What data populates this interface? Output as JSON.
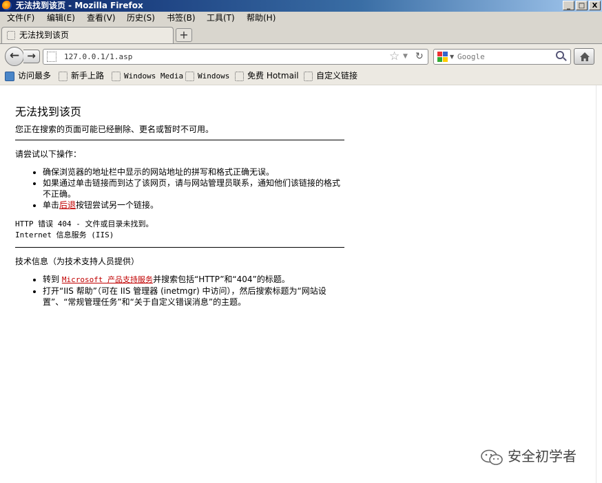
{
  "window": {
    "title": "无法找到该页 - Mozilla Firefox",
    "controls": [
      "_",
      "□",
      "X"
    ]
  },
  "menubar": [
    "文件(F)",
    "编辑(E)",
    "查看(V)",
    "历史(S)",
    "书签(B)",
    "工具(T)",
    "帮助(H)"
  ],
  "tab": {
    "label": "无法找到该页",
    "new_tab": "+"
  },
  "navigation": {
    "url": "127.0.0.1/1.asp",
    "search_placeholder": "Google"
  },
  "bookmarks": [
    "访问最多",
    "新手上路",
    "Windows Media",
    "Windows",
    "免费 Hotmail",
    "自定义链接"
  ],
  "page": {
    "heading": "无法找到该页",
    "subtitle": "您正在搜索的页面可能已经删除、更名或暂时不可用。",
    "try_label": "请尝试以下操作：",
    "tips": {
      "t1": "确保浏览器的地址栏中显示的网站地址的拼写和格式正确无误。",
      "t2": "如果通过单击链接而到达了该网页，请与网站管理员联系，通知他们该链接的格式不正确。",
      "t3_before": "单击",
      "t3_link": "后退",
      "t3_after": "按钮尝试另一个链接。"
    },
    "error_line": "HTTP 错误 404 - 文件或目录未找到。",
    "iis_line": "Internet 信息服务 (IIS)",
    "tech_label": "技术信息（为技术支持人员提供）",
    "tech": {
      "t1_before": "转到 ",
      "t1_link": "Microsoft 产品支持服务",
      "t1_after": "并搜索包括“HTTP”和“404”的标题。",
      "t2": "打开“IIS 帮助”（可在 IIS 管理器 (inetmgr) 中访问），然后搜索标题为“网站设置”、“常规管理任务”和“关于自定义错误消息”的主题。"
    }
  },
  "watermark": "安全初学者"
}
